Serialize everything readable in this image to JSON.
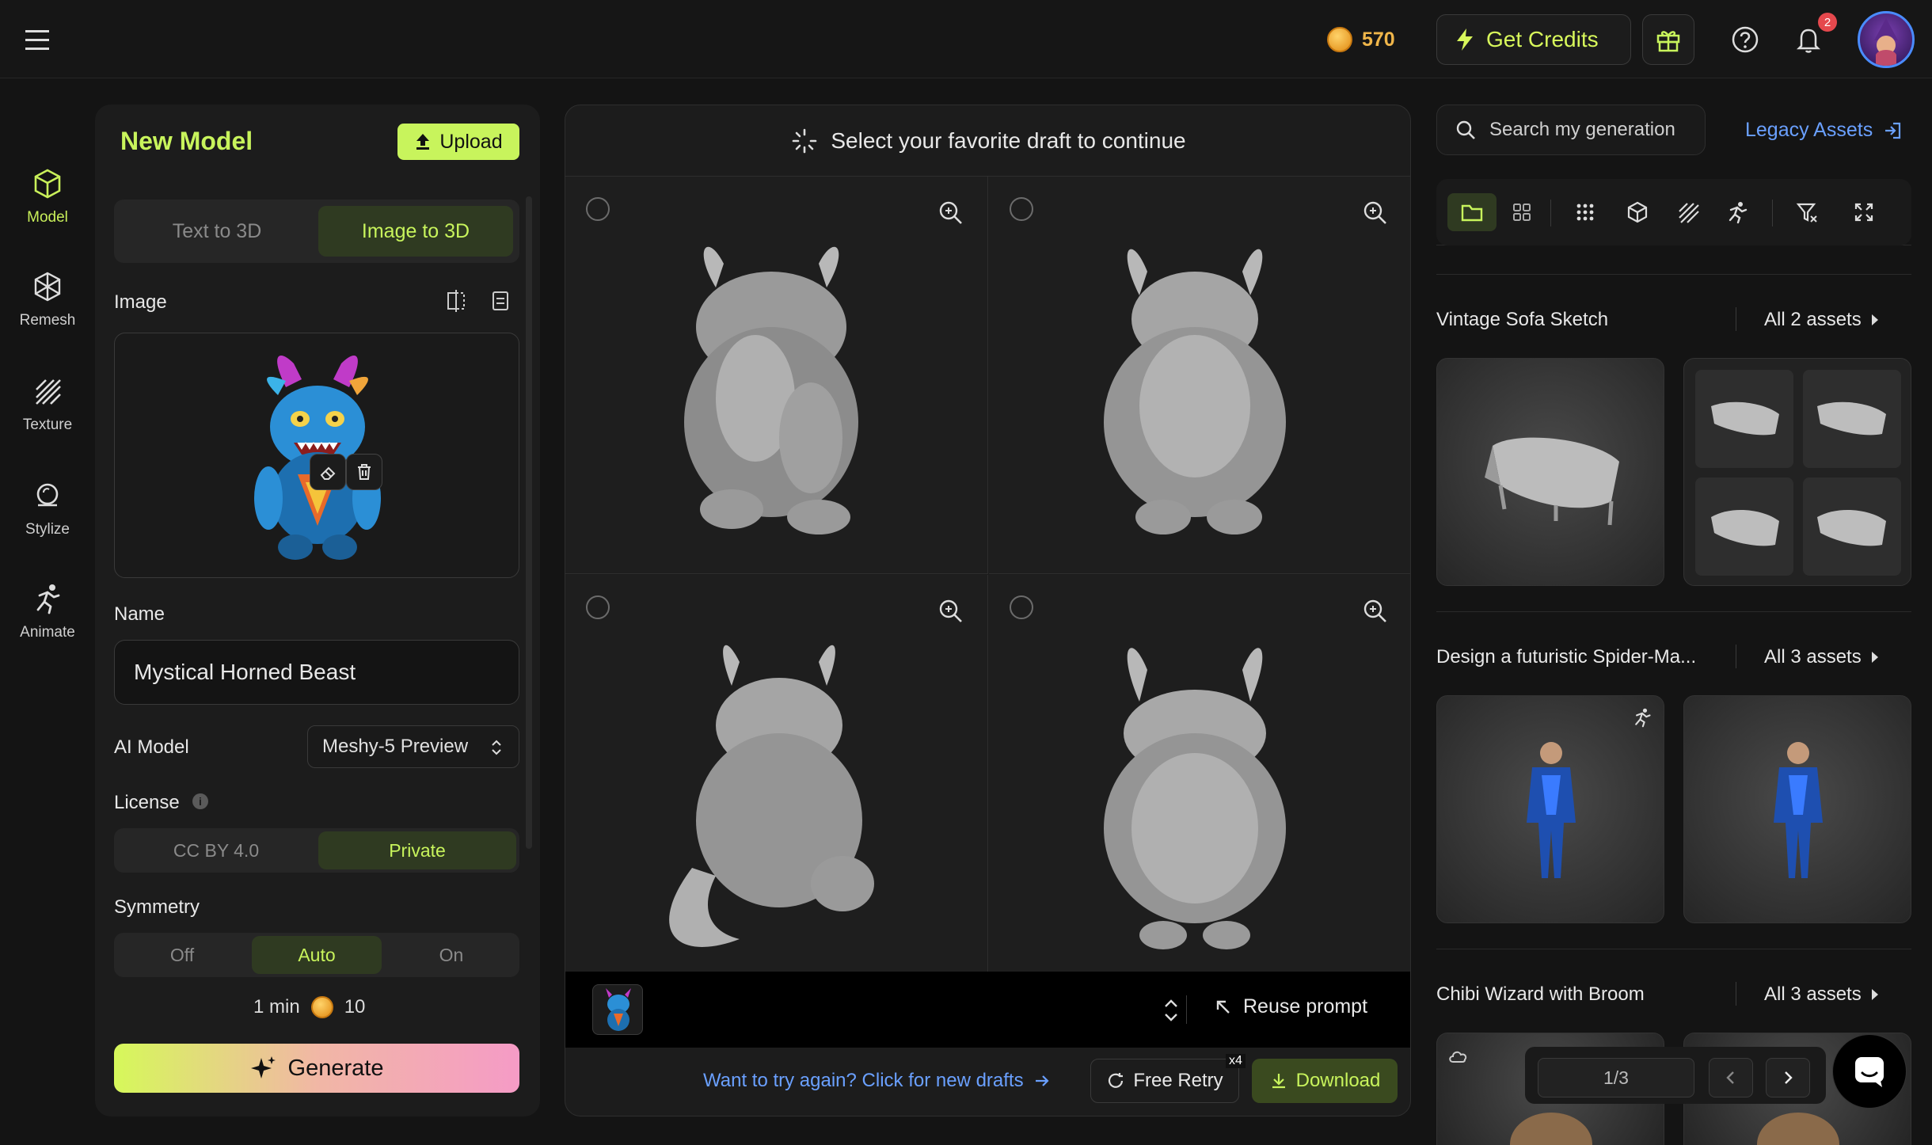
{
  "topbar": {
    "credits": "570",
    "get_credits_label": "Get Credits",
    "notification_count": "2"
  },
  "leftnav": [
    {
      "label": "Model",
      "icon": "cube-icon"
    },
    {
      "label": "Remesh",
      "icon": "remesh-icon"
    },
    {
      "label": "Texture",
      "icon": "texture-icon"
    },
    {
      "label": "Stylize",
      "icon": "stylize-icon"
    },
    {
      "label": "Animate",
      "icon": "animate-icon"
    }
  ],
  "panel": {
    "title": "New Model",
    "upload_label": "Upload",
    "mode_tabs": [
      "Text to 3D",
      "Image to 3D"
    ],
    "image_label": "Image",
    "name_label": "Name",
    "name_value": "Mystical Horned Beast",
    "ai_model_label": "AI Model",
    "ai_model_value": "Meshy-5 Preview",
    "license_label": "License",
    "license_options": [
      "CC BY 4.0",
      "Private"
    ],
    "symmetry_label": "Symmetry",
    "symmetry_options": [
      "Off",
      "Auto",
      "On"
    ],
    "time": "1 min",
    "cost": "10",
    "generate_label": "Generate"
  },
  "center": {
    "header": "Select your favorite draft to continue",
    "reuse_prompt": "Reuse prompt",
    "retry_link": "Want to try again? Click for new drafts",
    "free_retry": "Free Retry",
    "retry_count": "x4",
    "download": "Download"
  },
  "right": {
    "search_placeholder": "Search my generation",
    "legacy_assets": "Legacy Assets",
    "sections": [
      {
        "title": "Vintage Sofa Sketch",
        "all": "All 2 assets"
      },
      {
        "title": "Design a futuristic Spider-Ma...",
        "all": "All 3 assets"
      },
      {
        "title": "Chibi Wizard with Broom",
        "all": "All 3 assets"
      }
    ],
    "page": "1/3"
  },
  "colors": {
    "accent": "#c8f45c",
    "link": "#6aa0ff",
    "bg": "#141414",
    "panel": "#1c1c1c"
  }
}
